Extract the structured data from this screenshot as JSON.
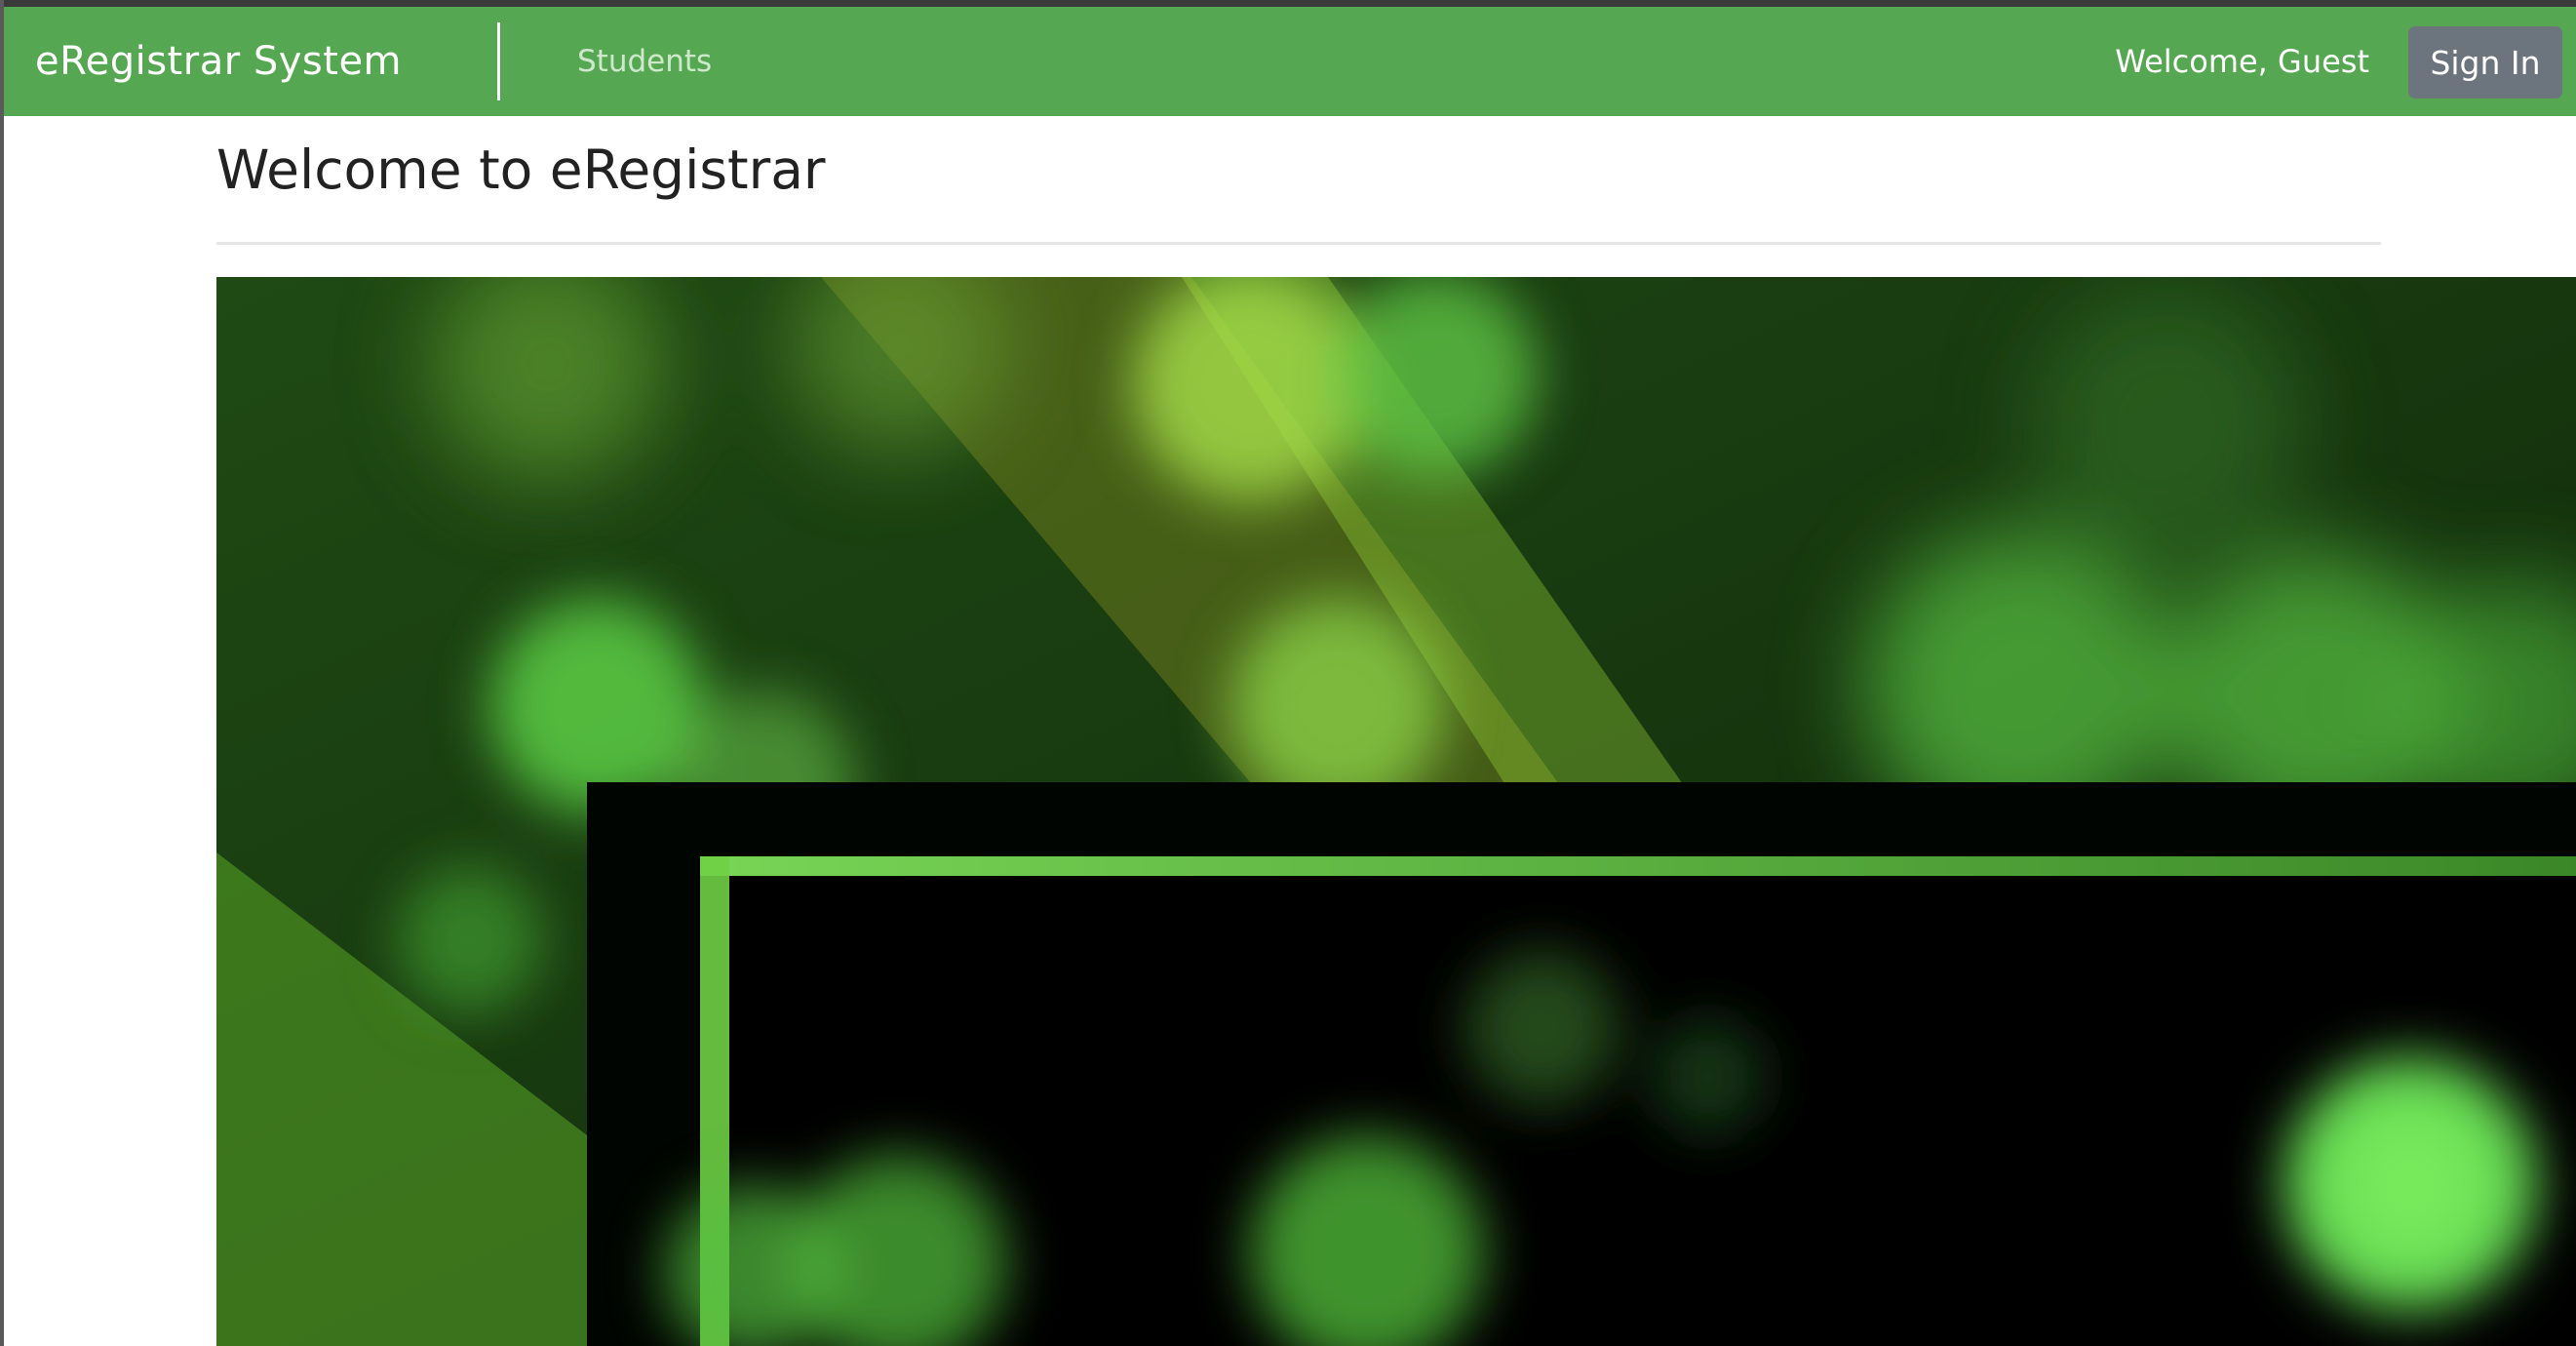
{
  "app": {
    "brand": "eRegistrar System"
  },
  "nav": {
    "items": [
      {
        "label": "Students"
      }
    ],
    "welcome_text": "Welcome, Guest",
    "sign_in_label": "Sign In"
  },
  "main": {
    "title": "Welcome to eRegistrar"
  },
  "colors": {
    "navbar": "#55a851",
    "sign_in_button": "#6c757d",
    "hero_glow": "#6ee85a"
  },
  "icons": {}
}
